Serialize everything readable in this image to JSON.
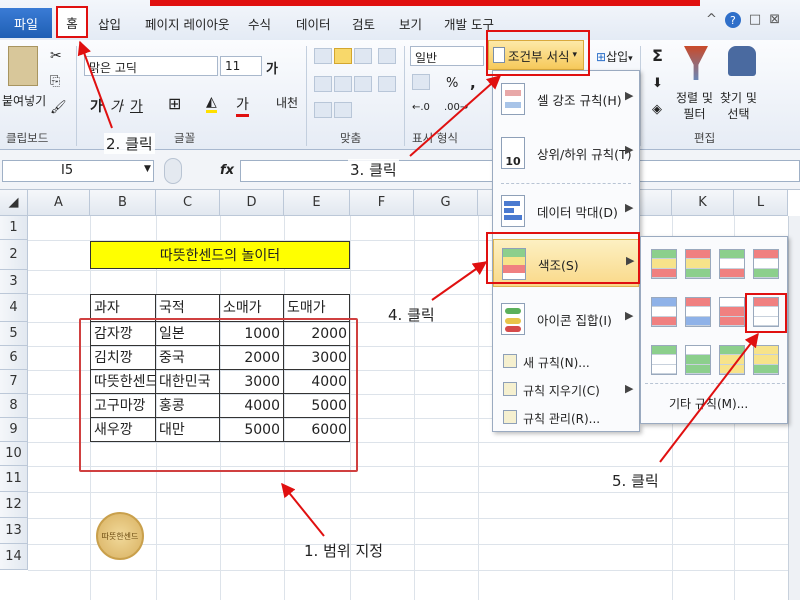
{
  "tabs": {
    "file": "파일",
    "home": "홈",
    "items": [
      "삽입",
      "페이지 레이아웃",
      "수식",
      "데이터",
      "검토",
      "보기",
      "개발 도구"
    ]
  },
  "window_controls": [
    "^",
    "?",
    "□",
    "⊠"
  ],
  "ribbon": {
    "paste_label": "붙여넣기",
    "font_name": "맑은 고딕",
    "font_size": "11",
    "number_format": "일반",
    "cond_format_button": "조건부 서식",
    "insert_button": "삽입",
    "sort_filter": "정렬 및\n필터",
    "find_select": "찾기 및\n선택",
    "groups": {
      "clipboard": "클립보드",
      "font": "글꼴",
      "align": "맞춤",
      "number": "표시 형식",
      "edit": "편집"
    },
    "font_buttons": [
      "가",
      "가",
      "가"
    ],
    "number_buttons": [
      "%",
      ","
    ]
  },
  "formula_bar": {
    "name_box": "I5",
    "fx": "fx",
    "value": ""
  },
  "grid": {
    "columns": [
      "A",
      "B",
      "C",
      "D",
      "E",
      "F",
      "G",
      "K",
      "L"
    ],
    "rows": [
      "1",
      "2",
      "3",
      "4",
      "5",
      "6",
      "7",
      "8",
      "9",
      "10",
      "11",
      "12",
      "13",
      "14"
    ],
    "title": "따뜻한센드의 놀이터",
    "headers": [
      "과자",
      "국적",
      "소매가",
      "도매가"
    ],
    "data": [
      [
        "감자깡",
        "일본",
        "1000",
        "2000"
      ],
      [
        "김치깡",
        "중국",
        "2000",
        "3000"
      ],
      [
        "따뜻한센드",
        "대한민국",
        "3000",
        "4000"
      ],
      [
        "고구마깡",
        "홍콩",
        "4000",
        "5000"
      ],
      [
        "새우깡",
        "대만",
        "5000",
        "6000"
      ]
    ]
  },
  "cf_menu": {
    "items": [
      {
        "label": "셀 강조 규칙(H)"
      },
      {
        "label": "상위/하위 규칙(T)"
      },
      {
        "label": "데이터 막대(D)"
      },
      {
        "label": "색조(S)"
      },
      {
        "label": "아이콘 집합(I)"
      }
    ],
    "small_items": [
      {
        "label": "새 규칙(N)..."
      },
      {
        "label": "규칙 지우기(C)"
      },
      {
        "label": "규칙 관리(R)..."
      }
    ]
  },
  "gallery": {
    "more_rules": "기타 규칙(M)...",
    "colors": {
      "red": "#f08080",
      "yellow": "#f7e38a",
      "green": "#8ccf8c",
      "blue": "#8fb2e8",
      "white": "#ffffff"
    }
  },
  "annotations": {
    "step1": "1. 범위 지정",
    "step2": "2. 클릭",
    "step3": "3. 클릭",
    "step4": "4. 클릭",
    "step5": "5. 클릭"
  },
  "stamp_text": "따뜻한센드",
  "accent": "#e01010"
}
